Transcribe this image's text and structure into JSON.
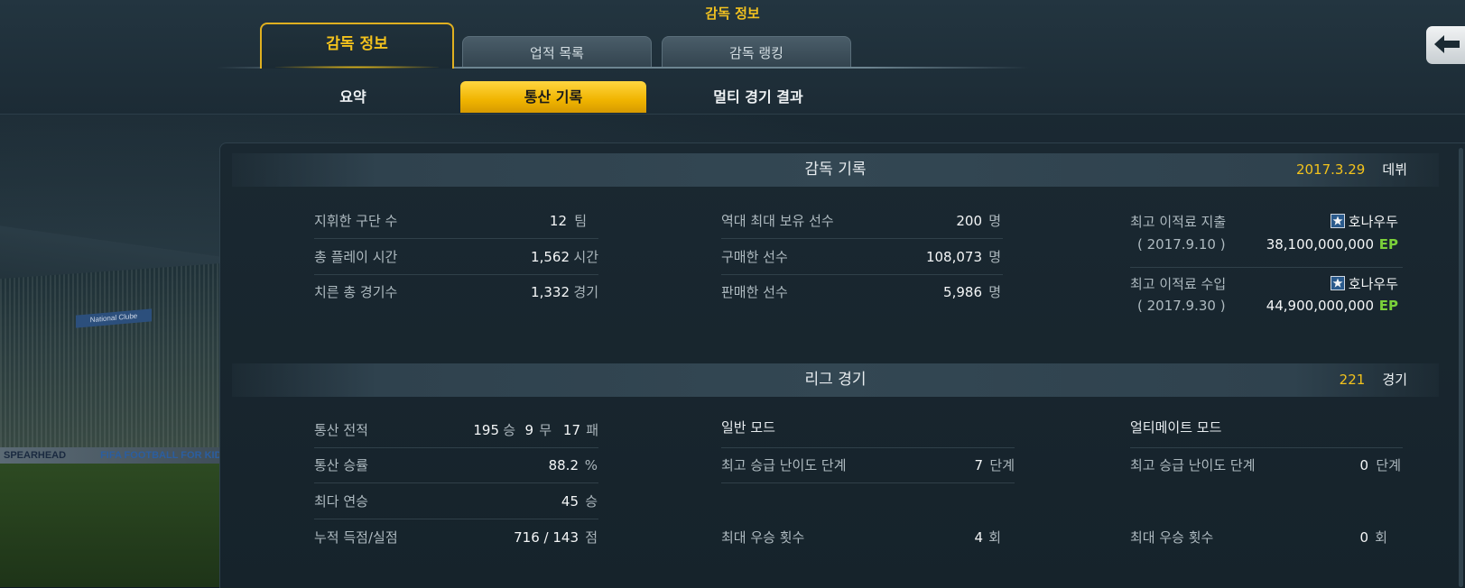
{
  "header": {
    "title": "감독 정보",
    "tabs": [
      {
        "label": "감독 정보",
        "active": true
      },
      {
        "label": "업적 목록",
        "active": false
      },
      {
        "label": "감독 랭킹",
        "active": false
      }
    ],
    "subtabs": [
      {
        "label": "요약",
        "active": false
      },
      {
        "label": "통산 기록",
        "active": true
      },
      {
        "label": "멀티 경기 결과",
        "active": false
      }
    ],
    "back_icon": "arrow-left-icon"
  },
  "background": {
    "ad_text_1": "SPEARHEAD",
    "ad_text_2": "FIFA FOOTBALL FOR KIDS",
    "club_sign": "National Clube"
  },
  "manager_record": {
    "title": "감독 기록",
    "debut_date": "2017.3.29",
    "debut_label": "데뷔",
    "col1": [
      {
        "label": "지휘한 구단 수",
        "value": "12",
        "unit": "팀"
      },
      {
        "label": "총 플레이 시간",
        "value": "1,562",
        "unit": "시간"
      },
      {
        "label": "치른 총 경기수",
        "value": "1,332",
        "unit": "경기"
      }
    ],
    "col2": [
      {
        "label": "역대 최대 보유 선수",
        "value": "200",
        "unit": "명"
      },
      {
        "label": "구매한 선수",
        "value": "108,073",
        "unit": "명"
      },
      {
        "label": "판매한 선수",
        "value": "5,986",
        "unit": "명"
      }
    ],
    "transfer_out": {
      "label": "최고 이적료 지출",
      "date": "( 2017.9.10 )",
      "player": "호나우두",
      "amount": "38,100,000,000",
      "currency": "EP"
    },
    "transfer_in": {
      "label": "최고 이적료 수입",
      "date": "( 2017.9.30 )",
      "player": "호나우두",
      "amount": "44,900,000,000",
      "currency": "EP"
    }
  },
  "league": {
    "title": "리그 경기",
    "games": "221",
    "games_label": "경기",
    "record_label": "통산 전적",
    "wins": "195",
    "wins_unit": "승",
    "draws": "9",
    "draws_unit": "무",
    "losses": "17",
    "losses_unit": "패",
    "win_rate_label": "통산 승률",
    "win_rate": "88.2",
    "win_rate_unit": "%",
    "streak_label": "최다 연승",
    "streak": "45",
    "streak_unit": "승",
    "goals_label": "누적 득점/실점",
    "goals": "716 / 143",
    "goals_unit": "점",
    "normal_mode": {
      "title": "일반 모드",
      "promo_label": "최고 승급 난이도 단계",
      "promo_value": "7",
      "promo_unit": "단계",
      "wins_label": "최대 우승 횟수",
      "wins_value": "4",
      "wins_unit": "회"
    },
    "ultimate_mode": {
      "title": "얼티메이트 모드",
      "promo_label": "최고 승급 난이도 단계",
      "promo_value": "0",
      "promo_unit": "단계",
      "wins_label": "최대 우승 횟수",
      "wins_value": "0",
      "wins_unit": "회"
    }
  }
}
